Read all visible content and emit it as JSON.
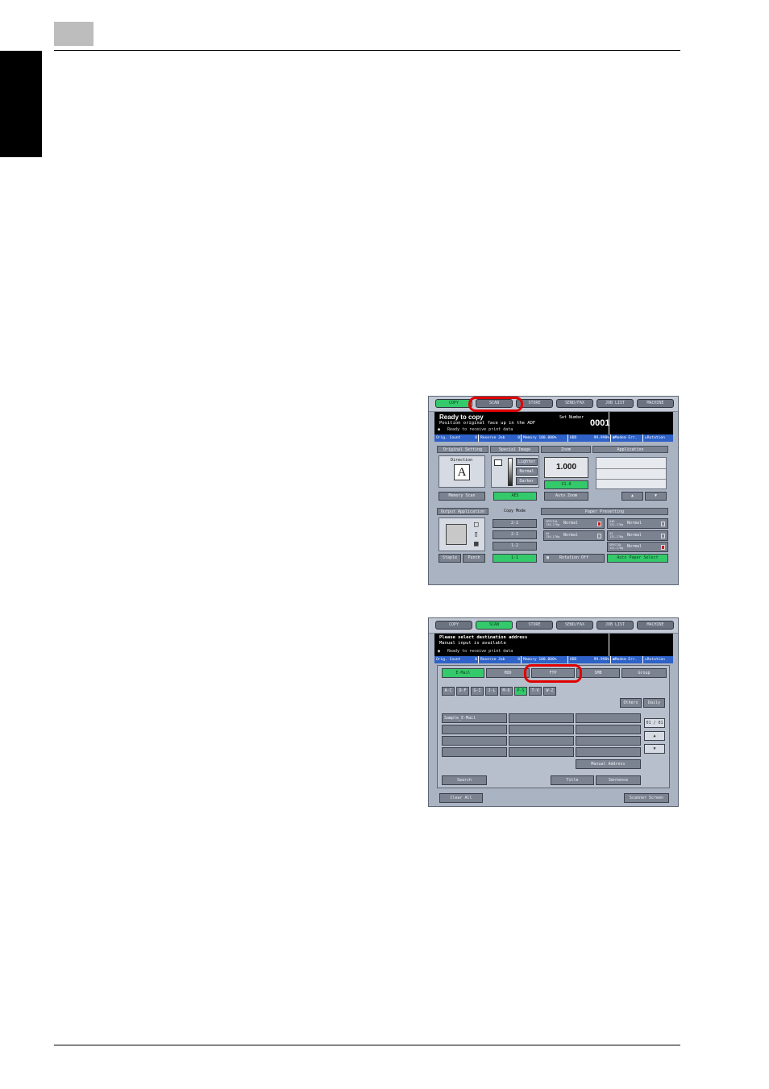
{
  "screen1": {
    "tabs": [
      "COPY",
      "SCAN",
      "STORE",
      "SEND/FAX",
      "JOB LIST",
      "MACHINE"
    ],
    "active_tab": 0,
    "message": {
      "line1": "Ready to copy",
      "line2": "Position original face up in the ADF",
      "line3": "Ready to receive print data",
      "set_number_label": "Set Number",
      "set_number": "0001"
    },
    "status": [
      "Orig. Count",
      "0",
      "Reserve Job",
      "0",
      "Memory",
      "100.000%",
      "HDD",
      "99.998%",
      "Modem Err.",
      "Rotation"
    ],
    "headers": [
      "Original Setting",
      "Special Image",
      "Zoom",
      "Application"
    ],
    "direction_label": "Direction",
    "direction_letter": "A",
    "density": [
      "Lighter",
      "Normal",
      "Darker"
    ],
    "zoom_value": "1.000",
    "zoom_preset": "X1.0",
    "memory_scan": "Memory Scan",
    "aes": "AES",
    "auto_zoom": "Auto Zoom",
    "headers2": [
      "Output Application",
      "Copy Mode",
      "Paper Presetting"
    ],
    "copy_modes": [
      "2-2",
      "2-1",
      "1-2",
      "1-1"
    ],
    "staple": "Staple",
    "punch": "Punch",
    "paper_left": [
      {
        "size": "SPECIAL",
        "weight": "136-176g",
        "mode": "Normal"
      },
      {
        "size": "A4",
        "weight": "136-176g",
        "mode": "Normal"
      }
    ],
    "paper_right": [
      {
        "size": "A4R",
        "weight": "131-176g",
        "mode": "Normal"
      },
      {
        "size": "A3",
        "weight": "131-176g",
        "mode": "Normal"
      },
      {
        "size": "SPECIAL",
        "weight": "131-176g",
        "mode": "Normal"
      }
    ],
    "rotation_off": "Rotation Off",
    "auto_paper": "Auto Paper Select"
  },
  "screen2": {
    "tabs": [
      "COPY",
      "SCAN",
      "STORE",
      "SEND/FAX",
      "JOB LIST",
      "MACHINE"
    ],
    "active_tab": 1,
    "message": {
      "line1": "Please select destination address",
      "line2": "Manual input is available",
      "line3": "Ready to receive print data"
    },
    "status": [
      "Orig. Count",
      "0",
      "Reserve Job",
      "0",
      "Memory",
      "100.000%",
      "HDD",
      "99.998%",
      "Modem Err.",
      "Rotation"
    ],
    "dest_tabs": [
      "E-Mail",
      "HDD",
      "FTP",
      "SMB",
      "Group"
    ],
    "index_tabs": [
      "A-C",
      "D-F",
      "G-I",
      "J-L",
      "M-O",
      "P-S",
      "T-V",
      "W-Z"
    ],
    "active_index": 5,
    "others": "Others",
    "daily": "Daily",
    "entry1": "Sample_E-Mail",
    "page": "01 / 01",
    "manual_address": "Manual Address",
    "search": "Search",
    "title": "Title",
    "sentence": "Sentence",
    "clear_all": "Clear All",
    "scanner_screen": "Scanner Screen"
  },
  "highlight_color": "#e00000"
}
